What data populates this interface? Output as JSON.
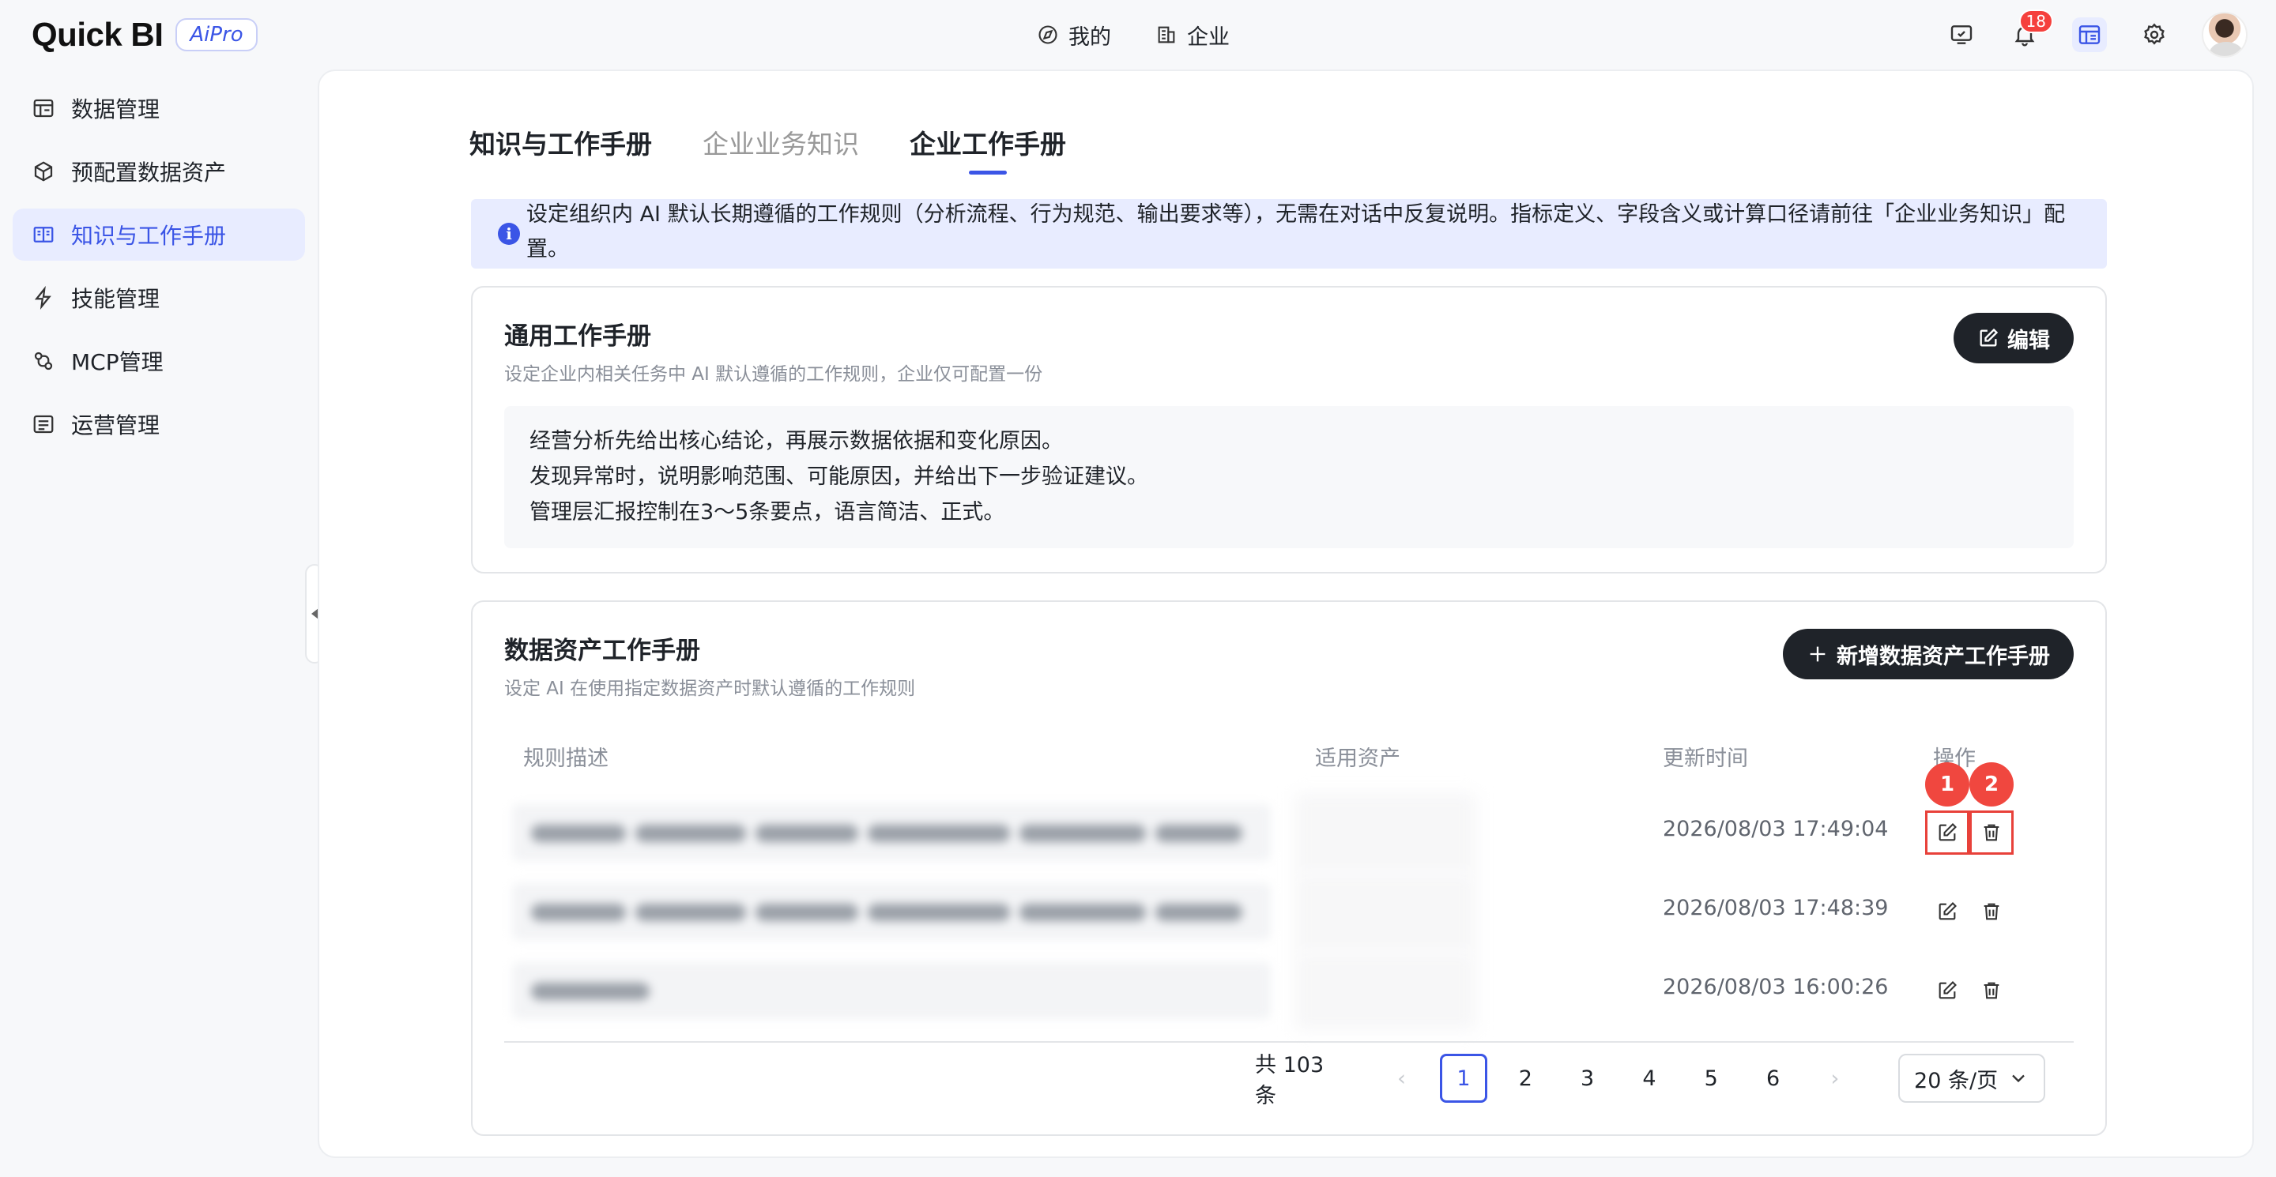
{
  "brand": {
    "name": "Quick BI",
    "edition": "AiPro"
  },
  "topnav": {
    "mine": "我的",
    "enterprise": "企业"
  },
  "notifications": {
    "count": "18"
  },
  "sidebar": {
    "items": [
      {
        "label": "数据管理",
        "icon": "data-table-icon"
      },
      {
        "label": "预配置数据资产",
        "icon": "cube-icon"
      },
      {
        "label": "知识与工作手册",
        "icon": "book-icon",
        "active": true
      },
      {
        "label": "技能管理",
        "icon": "lightning-icon"
      },
      {
        "label": "MCP管理",
        "icon": "plug-icon"
      },
      {
        "label": "运营管理",
        "icon": "list-icon"
      }
    ]
  },
  "tabs": {
    "title": "知识与工作手册",
    "business_knowledge": "企业业务知识",
    "work_manual": "企业工作手册"
  },
  "info": {
    "text": "设定组织内 AI 默认长期遵循的工作规则（分析流程、行为规范、输出要求等），无需在对话中反复说明。指标定义、字段含义或计算口径请前往「企业业务知识」配置。"
  },
  "general": {
    "title": "通用工作手册",
    "subtitle": "设定企业内相关任务中 AI 默认遵循的工作规则，企业仅可配置一份",
    "edit_label": "编辑",
    "rules": [
      "经营分析先给出核心结论，再展示数据依据和变化原因。",
      "发现异常时，说明影响范围、可能原因，并给出下一步验证建议。",
      "管理层汇报控制在3～5条要点，语言简洁、正式。"
    ]
  },
  "asset_manual": {
    "title": "数据资产工作手册",
    "subtitle": "设定 AI 在使用指定数据资产时默认遵循的工作规则",
    "add_label": "新增数据资产工作手册",
    "columns": {
      "desc": "规则描述",
      "asset": "适用资产",
      "updated": "更新时间",
      "actions": "操作"
    },
    "rows": [
      {
        "updated": "2026/08/03 17:49:04"
      },
      {
        "updated": "2026/08/03 17:48:39"
      },
      {
        "updated": "2026/08/03 16:00:26"
      }
    ],
    "markers": {
      "edit": "1",
      "delete": "2"
    }
  },
  "pagination": {
    "total": "共 103 条",
    "pages": [
      "1",
      "2",
      "3",
      "4",
      "5",
      "6"
    ],
    "current": "1",
    "prev": "‹",
    "next": "›",
    "page_size": "20 条/页"
  },
  "colors": {
    "accent": "#3b55e6",
    "highlight": "#e8413a",
    "dark_button": "#1f2329"
  }
}
